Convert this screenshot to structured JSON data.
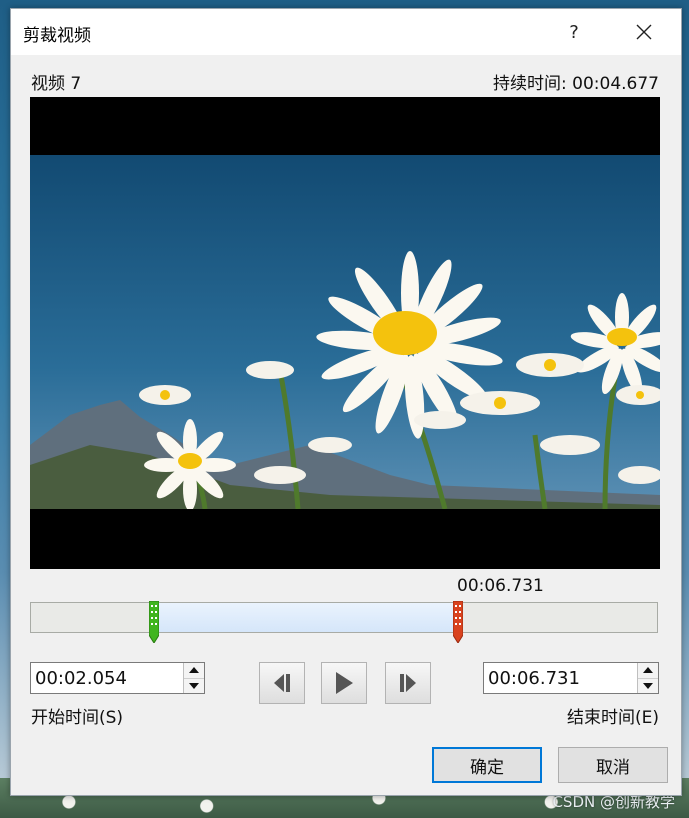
{
  "dialog": {
    "title": "剪裁视频",
    "help_label": "?",
    "video_name": "视频 7",
    "duration_text": "持续时间: 00:04.677"
  },
  "trim": {
    "marker_time": "00:06.731",
    "start_fraction": 0.197,
    "end_fraction": 0.682
  },
  "start": {
    "value": "00:02.054",
    "label": "开始时间(S)"
  },
  "end": {
    "value": "00:06.731",
    "label": "结束时间(E)"
  },
  "buttons": {
    "ok": "确定",
    "cancel": "取消"
  },
  "watermark": "CSDN @创新教学",
  "colors": {
    "start_handle": "#3fb51e",
    "end_handle": "#d9431f",
    "selection": "#d5e6fa",
    "focus_border": "#0078d7"
  }
}
